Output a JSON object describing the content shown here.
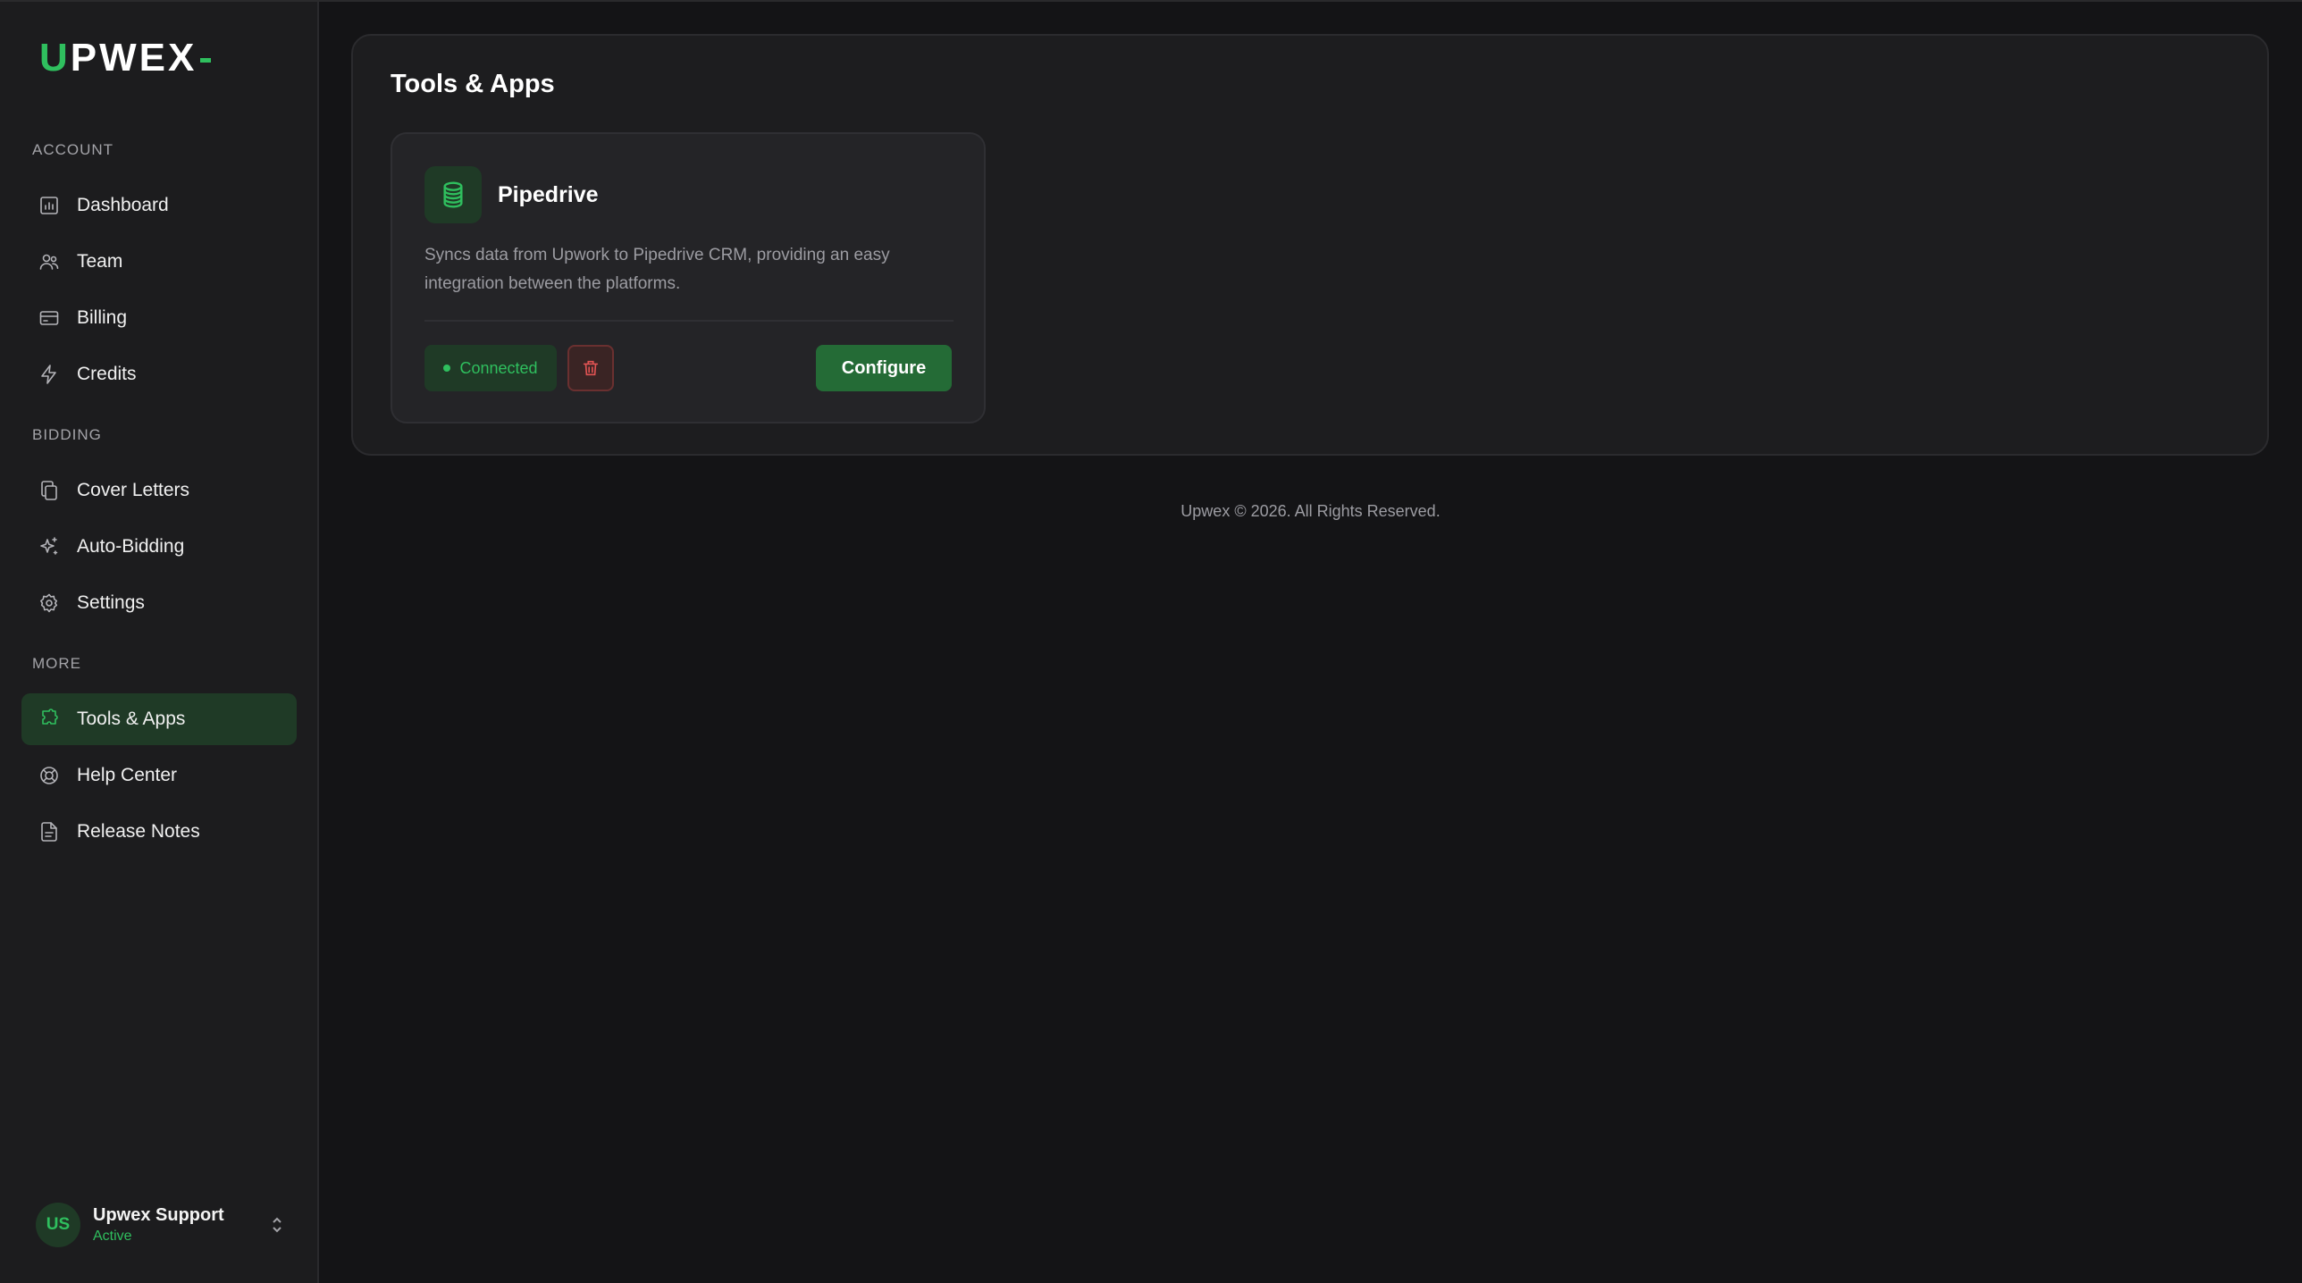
{
  "brand": {
    "logo_first": "U",
    "logo_rest": "PWEX"
  },
  "sidebar": {
    "sections": [
      {
        "label": "ACCOUNT"
      },
      {
        "label": "BIDDING"
      },
      {
        "label": "MORE"
      }
    ],
    "items": [
      {
        "label": "Dashboard",
        "icon": "chart-icon"
      },
      {
        "label": "Team",
        "icon": "users-icon"
      },
      {
        "label": "Billing",
        "icon": "credit-card-icon"
      },
      {
        "label": "Credits",
        "icon": "bolt-icon"
      },
      {
        "label": "Cover Letters",
        "icon": "copy-icon"
      },
      {
        "label": "Auto-Bidding",
        "icon": "sparkles-icon"
      },
      {
        "label": "Settings",
        "icon": "gear-icon"
      },
      {
        "label": "Tools & Apps",
        "icon": "puzzle-icon",
        "active": true
      },
      {
        "label": "Help Center",
        "icon": "lifebuoy-icon"
      },
      {
        "label": "Release Notes",
        "icon": "document-icon"
      }
    ]
  },
  "user": {
    "initials": "US",
    "name": "Upwex Support",
    "status": "Active"
  },
  "main": {
    "title": "Tools & Apps",
    "card": {
      "title": "Pipedrive",
      "icon": "database-icon",
      "description": "Syncs data from Upwork to Pipedrive CRM, providing an easy integration between the platforms.",
      "status": "Connected",
      "configure_label": "Configure"
    }
  },
  "footer": "Upwex © 2026. All Rights Reserved.",
  "colors": {
    "accent": "#2fbf5e",
    "danger": "#e05353",
    "background": "#141416",
    "sidebar": "#1c1c1e"
  }
}
